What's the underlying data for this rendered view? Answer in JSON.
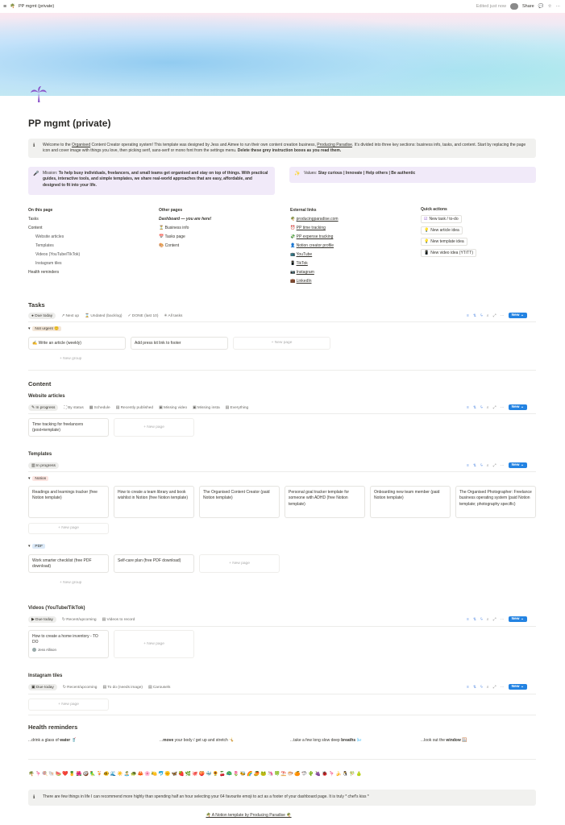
{
  "topbar": {
    "page_icon": "🌴",
    "title": "PP mgmt (private)",
    "edited": "Edited just now",
    "share": "Share"
  },
  "page": {
    "title": "PP mgmt (private)",
    "icon": "🌴"
  },
  "intro": {
    "part1": "Welcome to the ",
    "link1": "Organised",
    "part2": " Content Creator operating system! This template was designed by Jess and Aimee to run their own content creation business, ",
    "link2": "Producing Paradise",
    "part3": ". It's divided into three key sections: business info, tasks, and content. Start by replacing the page icon and cover image with things you love, then picking serif, sans-serif or mono font from the settings menu. ",
    "bold": "Delete these grey instruction boxes as you read them."
  },
  "mission": {
    "label": "Mission: ",
    "text": "To help busy individuals, freelancers, and small teams get organised and stay on top of things. With practical guides, interactive tools, and simple templates, we share real-world approaches that are easy, affordable, and designed to fit into your life."
  },
  "values": {
    "label": "Values: ",
    "text": "Stay curious | Innovate | Help others | Be authentic"
  },
  "on_this_page": {
    "heading": "On this page",
    "items": [
      "Tasks",
      "Content",
      "Website articles",
      "Templates",
      "Videos (YouTube/TikTok)",
      "Instagram tiles",
      "Health reminders"
    ]
  },
  "other_pages": {
    "heading": "Other pages",
    "current": "Dashboard — you are here!",
    "items": [
      {
        "icon": "⏳",
        "label": "Business info"
      },
      {
        "icon": "📅",
        "label": "Tasks page"
      },
      {
        "icon": "🎨",
        "label": "Content"
      }
    ]
  },
  "external_links": {
    "heading": "External links",
    "items": [
      {
        "icon": "🌴",
        "label": "producingparadise.com"
      },
      {
        "icon": "⏰",
        "label": "PP time tracking"
      },
      {
        "icon": "💸",
        "label": "PP expense tracking"
      },
      {
        "icon": "👤",
        "label": "Notion creator profile"
      },
      {
        "icon": "📺",
        "label": "YouTube"
      },
      {
        "icon": "📱",
        "label": "TikTok"
      },
      {
        "icon": "📷",
        "label": "Instagram"
      },
      {
        "icon": "💼",
        "label": "LinkedIn"
      }
    ]
  },
  "quick_actions": {
    "heading": "Quick actions",
    "items": [
      {
        "icon": "☑",
        "label": "New task / to-do"
      },
      {
        "icon": "💡",
        "label": "New article idea"
      },
      {
        "icon": "💡",
        "label": "New template idea"
      },
      {
        "icon": "📱",
        "label": "New video idea (YT/TT)"
      }
    ]
  },
  "tasks": {
    "heading": "Tasks",
    "tabs": [
      "Due today",
      "Next up",
      "Undated (backlog)",
      "DONE (last 10)",
      "All tasks"
    ],
    "group": "Not urgent 😊",
    "cards": [
      {
        "icon": "✍️",
        "label": "Write an article (weekly)"
      },
      {
        "icon": "",
        "label": "Add press kit link to footer"
      }
    ],
    "new_page": "+ New page",
    "new_group": "+ New group"
  },
  "content": {
    "heading": "Content",
    "articles": {
      "heading": "Website articles",
      "tabs": [
        "In progress",
        "By status",
        "Schedule",
        "Recently published",
        "Missing video",
        "Missing insta",
        "Everything"
      ],
      "cards": [
        "Time tracking for freelancers (post+template)"
      ],
      "new_page": "+ New page"
    },
    "templates": {
      "heading": "Templates",
      "tab": "In progress",
      "group1": "Notion",
      "cards1": [
        "Readings and learnings tracker (free Notion template)",
        "How to create a team library and book wishlist in Notion (free Notion template)",
        "The Organised Content Creator (paid Notion template)",
        "Personal goal tracker template for someone with ADHD (free Notion template)",
        "Onboarding new team member (paid Notion template)",
        "The Organised Photographer: Freelance business operating system (paid Notion template; photography specific)"
      ],
      "group2": "PDF",
      "cards2": [
        "Work smarter checklist (free PDF download)",
        "Self-care plan (free PDF download)"
      ],
      "new_page": "+ New page",
      "new_group": "+ New group"
    },
    "videos": {
      "heading": "Videos (YouTube/TikTok)",
      "tabs": [
        "Due today",
        "Recent/upcoming",
        "Videos to record"
      ],
      "card": "How to create a home inventory - TO DO",
      "card_person": "Jess Allison",
      "new_page": "+ New page"
    },
    "instagram": {
      "heading": "Instagram tiles",
      "tabs": [
        "Due today",
        "Recent/upcoming",
        "To do (needs image)",
        "Carousels"
      ],
      "new_page": "+ New page"
    }
  },
  "health": {
    "heading": "Health reminders",
    "items": [
      {
        "pre": "...drink a glass of ",
        "bold": "water",
        "post": " 🥤"
      },
      {
        "pre": "...",
        "bold": "move",
        "post": " your body / get up and stretch 🤸"
      },
      {
        "pre": "...take a few long slow deep ",
        "bold": "breaths",
        "post": " 🌬️"
      },
      {
        "pre": "...look out the ",
        "bold": "window",
        "post": " 🪟"
      }
    ]
  },
  "emoji_row": "🌴🦩🍭🐚🍉❤️🍍🌺🥥🦜🍹🐠🌊☀️🏝️🐢🦀🌸🍋🐬🌞🦋🍓🌿🐙🍑🐳🌻🍒🦚🌷🐝🌈🥭🐸🦄🍀⛱️🐡🍊🦈🌵🍇🐞🦩🍌🐧🎋🍐",
  "footer": {
    "callout": "There are few things in life I can recommend more highly than spending half an hour selecting your 64 favourite emoji to act as a footer of your dashboard page. It is truly * chef's kiss *",
    "credit": "🌴 A Notion template by Producing Paradise 🌴"
  },
  "new_label": "New"
}
